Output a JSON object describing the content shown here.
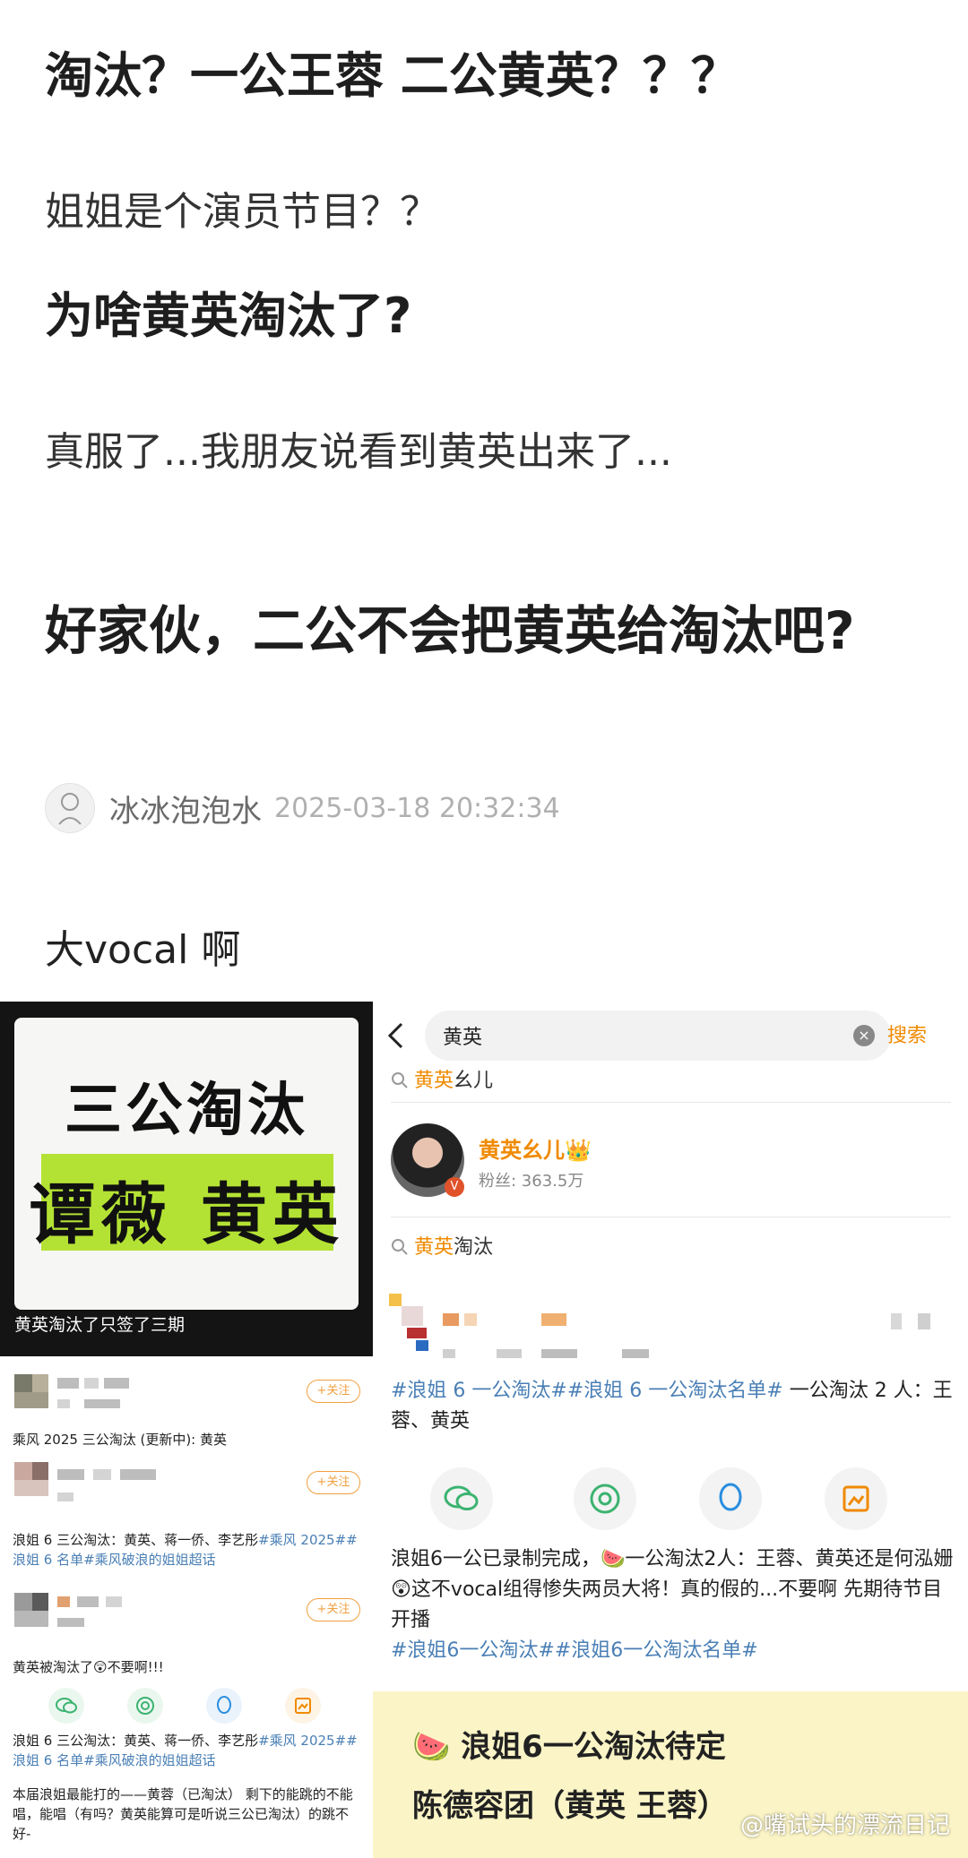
{
  "top": {
    "line1": "淘汰？一公王蓉 二公黄英？？？",
    "line2": "姐姐是个演员节目？？",
    "line3": "为啥黄英淘汰了?",
    "line4": "真服了...我朋友说看到黄英出来了...",
    "line5": "好家伙，二公不会把黄英给淘汰吧?",
    "author": "冰冰泡泡水",
    "time": "2025-03-18 20:32:34",
    "comment": "大vocal 啊"
  },
  "left": {
    "poster_line1": "三公淘汰",
    "poster_line2": "谭薇 黄英",
    "caption": "黄英淘汰了只签了三期",
    "follow": "+关注",
    "post1": "乘风 2025 三公淘汰 (更新中): 黄英",
    "post2_a": "浪姐 6 三公淘汰：黄英、蒋一侨、李艺彤",
    "post2_tags": "#乘风 2025##浪姐 6 名单#",
    "post2_b": "乘风破浪的姐姐超话",
    "post3": "黄英被淘汰了😲不要啊!!!",
    "post4_a": "浪姐 6 三公淘汰：黄英、蒋一侨、李艺彤",
    "post4_b": "#乘风 2025##浪姐 6 名单#",
    "post4_c": "乘风破浪的姐姐超话",
    "post5": "本届浪姐最能打的——黄蓉（已淘汰） 剩下的能跳的不能唱，能唱（有吗？黄英能算可是听说三公已淘汰）的跳不好-"
  },
  "right": {
    "search_query": "黄英",
    "search_button": "搜索",
    "suggest1_hi": "黄英",
    "suggest1_rest": "幺儿",
    "user_name": "黄英幺儿👑",
    "user_fans": "粉丝: 363.5万",
    "suggest2_hi": "黄英",
    "suggest2_rest": "淘汰",
    "post1_tags": "#浪姐 6 一公淘汰##浪姐 6 一公淘汰名单#",
    "post1_text": " 一公淘汰 2 人：王蓉、黄英",
    "post2_text": "浪姐6一公已录制完成，🍉一公淘汰2人：王蓉、黄英还是何泓姗😲这不vocal组得惨失两员大将！真的假的...不要啊 先期待节目开播",
    "post2_tags": "#浪姐6一公淘汰##浪姐6一公淘汰名单#",
    "card_line1": "🍉 浪姐6一公淘汰待定",
    "card_line2": "陈德容团（黄英 王蓉）"
  },
  "watermark": "@嘴试头的漂流日记",
  "colors": {
    "accent": "#f08a00",
    "tag": "#4a7fb5",
    "highlight": "#b4e234"
  }
}
